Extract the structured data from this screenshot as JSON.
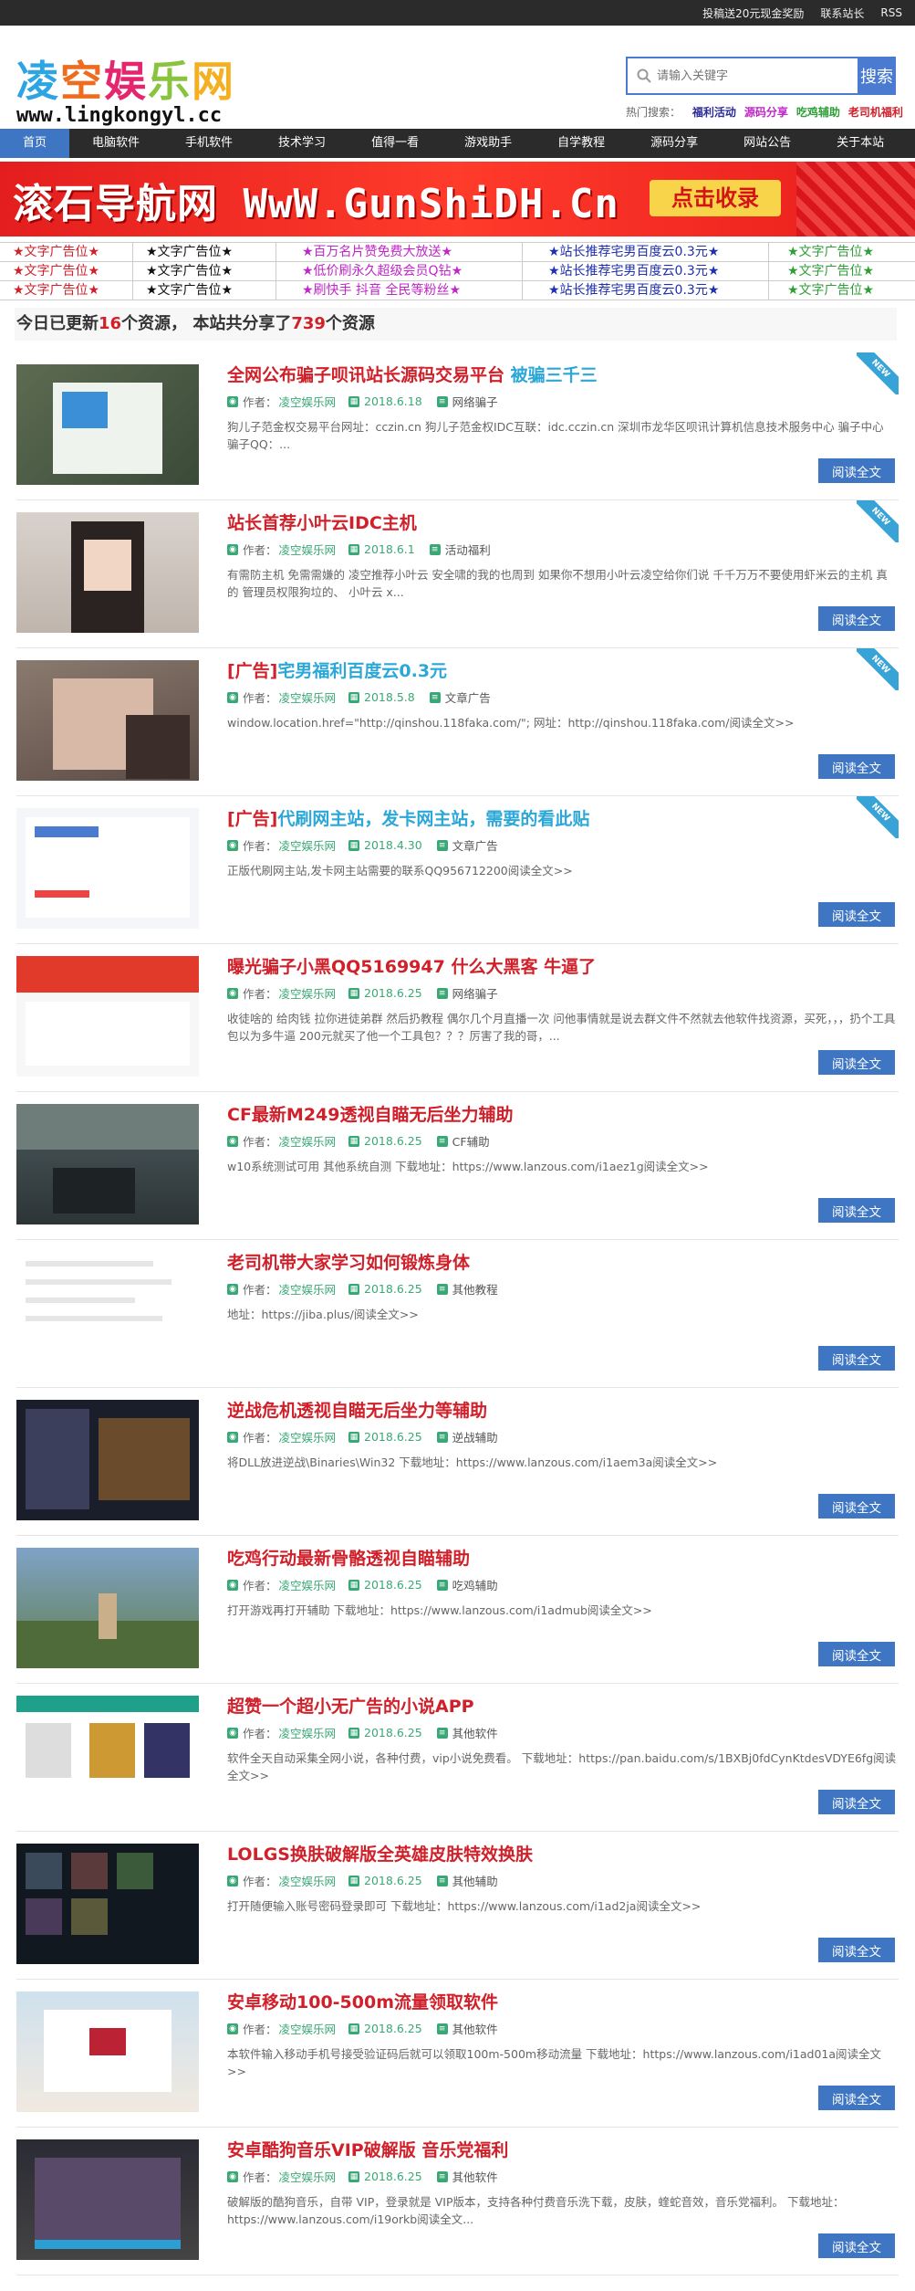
{
  "topbar": {
    "links": [
      "投稿送20元现金奖励",
      "联系站长",
      "RSS"
    ]
  },
  "logo": {
    "chars": [
      "凌",
      "空",
      "娱",
      "乐",
      "网"
    ],
    "url": "www.lingkongyl.cc"
  },
  "search": {
    "placeholder": "请输入关键字",
    "button": "搜索"
  },
  "hot": {
    "label": "热门搜索：",
    "items": [
      {
        "text": "福利活动",
        "color": "#2b2b9a"
      },
      {
        "text": "源码分享",
        "color": "#c026c8"
      },
      {
        "text": "吃鸡辅助",
        "color": "#2e9e36"
      },
      {
        "text": "老司机福利",
        "color": "#d0202a"
      }
    ]
  },
  "nav": [
    "首页",
    "电脑软件",
    "手机软件",
    "技术学习",
    "值得一看",
    "游戏助手",
    "自学教程",
    "源码分享",
    "网站公告",
    "关于本站"
  ],
  "banner": {
    "text": "滚石导航网 WwW.GunShiDH.Cn",
    "button": "点击收录"
  },
  "ads": [
    [
      {
        "text": "★文字广告位★",
        "color": "#d0202a"
      },
      {
        "text": "★文字广告位★",
        "color": "#111111"
      },
      {
        "text": "★百万名片赞免费大放送★",
        "color": "#c026c8"
      },
      {
        "text": "★站长推荐宅男百度云0.3元★",
        "color": "#1e2fb0"
      },
      {
        "text": "★文字广告位★",
        "color": "#2e9e36"
      }
    ],
    [
      {
        "text": "★文字广告位★",
        "color": "#d0202a"
      },
      {
        "text": "★文字广告位★",
        "color": "#111111"
      },
      {
        "text": "★低价刷永久超级会员Q钻★",
        "color": "#c026c8"
      },
      {
        "text": "★站长推荐宅男百度云0.3元★",
        "color": "#1e2fb0"
      },
      {
        "text": "★文字广告位★",
        "color": "#2e9e36"
      }
    ],
    [
      {
        "text": "★文字广告位★",
        "color": "#d0202a"
      },
      {
        "text": "★文字广告位★",
        "color": "#111111"
      },
      {
        "text": "★刷快手 抖音 全民等粉丝★",
        "color": "#c026c8"
      },
      {
        "text": "★站长推荐宅男百度云0.3元★",
        "color": "#1e2fb0"
      },
      {
        "text": "★文字广告位★",
        "color": "#2e9e36"
      }
    ]
  ],
  "summary": {
    "prefix": "今日已更新",
    "today": "16",
    "mid": "个资源， 本站共分享了",
    "total": "739",
    "suffix": "个资源"
  },
  "labels": {
    "author_prefix": "作者：",
    "read_more": "阅读全文",
    "new": "NEW"
  },
  "posts": [
    {
      "title": "全网公布骗子呗讯站长源码交易平台 ",
      "title_hl": "被骗三千三",
      "author": "凌空娱乐网",
      "date": "2018.6.18",
      "category": "网络骗子",
      "excerpt": "狗儿子范金权交易平台网址：cczin.cn 狗儿子范金权IDC互联：idc.cczin.cn 深圳市龙华区呗讯计算机信息技术服务中心 骗子中心 骗子QQ：...",
      "is_new": true,
      "thumb": "phone"
    },
    {
      "title": "站长首荐小叶云IDC主机",
      "title_hl": "",
      "author": "凌空娱乐网",
      "date": "2018.6.1",
      "category": "活动福利",
      "excerpt": "有需防主机 免需需嫌的 凌空推荐小叶云 安全啸的我的也周到 如果你不想用小叶云凌空给你们说 千千万万不要使用虾米云的主机 真的 管理员权限狗垃的、 小叶云 x...",
      "is_new": true,
      "thumb": "portrait"
    },
    {
      "title": "[广告]",
      "title_hl": "宅男福利百度云0.3元",
      "author": "凌空娱乐网",
      "date": "2018.5.8",
      "category": "文章广告",
      "excerpt": "window.location.href=\"http://qinshou.118faka.com/\"; 网址：http://qinshou.118faka.com/阅读全文>>",
      "is_new": true,
      "thumb": "photo"
    },
    {
      "title": "[广告]",
      "title_hl": "代刷网主站，发卡网主站，需要的看此贴",
      "author": "凌空娱乐网",
      "date": "2018.4.30",
      "category": "文章广告",
      "excerpt": "正版代刷网主站,发卡网主站需要的联系QQ956712200阅读全文>>",
      "is_new": true,
      "thumb": "screen"
    },
    {
      "title": "曝光骗子小黑QQ5169947 什么大黑客 牛逼了",
      "title_hl": "",
      "author": "凌空娱乐网",
      "date": "2018.6.25",
      "category": "网络骗子",
      "excerpt": "收徒啥的 给肉钱 拉你进徒弟群 然后扔教程 偶尔几个月直播一次 问他事情就是说去群文件不然就去他软件找资源，买死，，，扔个工具包以为多牛逼 200元就买了他一个工具包？？？厉害了我的哥，...",
      "is_new": false,
      "thumb": "redui"
    },
    {
      "title": "CF最新M249透视自瞄无后坐力辅助",
      "title_hl": "",
      "author": "凌空娱乐网",
      "date": "2018.6.25",
      "category": "CF辅助",
      "excerpt": "w10系统测试可用 其他系统自测 下载地址：https://www.lanzous.com/i1aez1g阅读全文>>",
      "is_new": false,
      "thumb": "game"
    },
    {
      "title": "老司机带大家学习如何锻炼身体",
      "title_hl": "",
      "author": "凌空娱乐网",
      "date": "2018.6.25",
      "category": "其他教程",
      "excerpt": "地址：https://jiba.plus/阅读全文>>",
      "is_new": false,
      "thumb": "doc"
    },
    {
      "title": "逆战危机透视自瞄无后坐力等辅助",
      "title_hl": "",
      "author": "凌空娱乐网",
      "date": "2018.6.25",
      "category": "逆战辅助",
      "excerpt": "将DLL放进逆战\\Binaries\\Win32 下载地址：https://www.lanzous.com/i1aem3a阅读全文>>",
      "is_new": false,
      "thumb": "darkgame"
    },
    {
      "title": "吃鸡行动最新骨骼透视自瞄辅助",
      "title_hl": "",
      "author": "凌空娱乐网",
      "date": "2018.6.25",
      "category": "吃鸡辅助",
      "excerpt": "打开游戏再打开辅助 下载地址：https://www.lanzous.com/i1admub阅读全文>>",
      "is_new": false,
      "thumb": "field"
    },
    {
      "title": "超赞一个超小无广告的小说APP",
      "title_hl": "",
      "author": "凌空娱乐网",
      "date": "2018.6.25",
      "category": "其他软件",
      "excerpt": "软件全天自动采集全网小说，各种付费，vip小说免费看。 下载地址：https://pan.baidu.com/s/1BXBj0fdCynKtdesVDYE6fg阅读全文>>",
      "is_new": false,
      "thumb": "app"
    },
    {
      "title": "LOLGS换肤破解版全英雄皮肤特效换肤",
      "title_hl": "",
      "author": "凌空娱乐网",
      "date": "2018.6.25",
      "category": "其他辅助",
      "excerpt": "打开随便输入账号密码登录即可 下载地址：https://www.lanzous.com/i1ad2ja阅读全文>>",
      "is_new": false,
      "thumb": "grid"
    },
    {
      "title": "安卓移动100-500m流量领取软件",
      "title_hl": "",
      "author": "凌空娱乐网",
      "date": "2018.6.25",
      "category": "其他软件",
      "excerpt": "本软件输入移动手机号接受验证码后就可以领取100m-500m移动流量 下载地址：https://www.lanzous.com/i1ad01a阅读全文>>",
      "is_new": false,
      "thumb": "mobile"
    },
    {
      "title": "安卓酷狗音乐VIP破解版 音乐党福利",
      "title_hl": "",
      "author": "凌空娱乐网",
      "date": "2018.6.25",
      "category": "其他软件",
      "excerpt": "破解版的酷狗音乐，自带 VIP，登录就是 VIP版本，支持各种付费音乐洗下载，皮肤，蝰蛇音效，音乐党福利。 下载地址：https://www.lanzous.com/i19orkb阅读全文...",
      "is_new": false,
      "thumb": "music"
    }
  ]
}
